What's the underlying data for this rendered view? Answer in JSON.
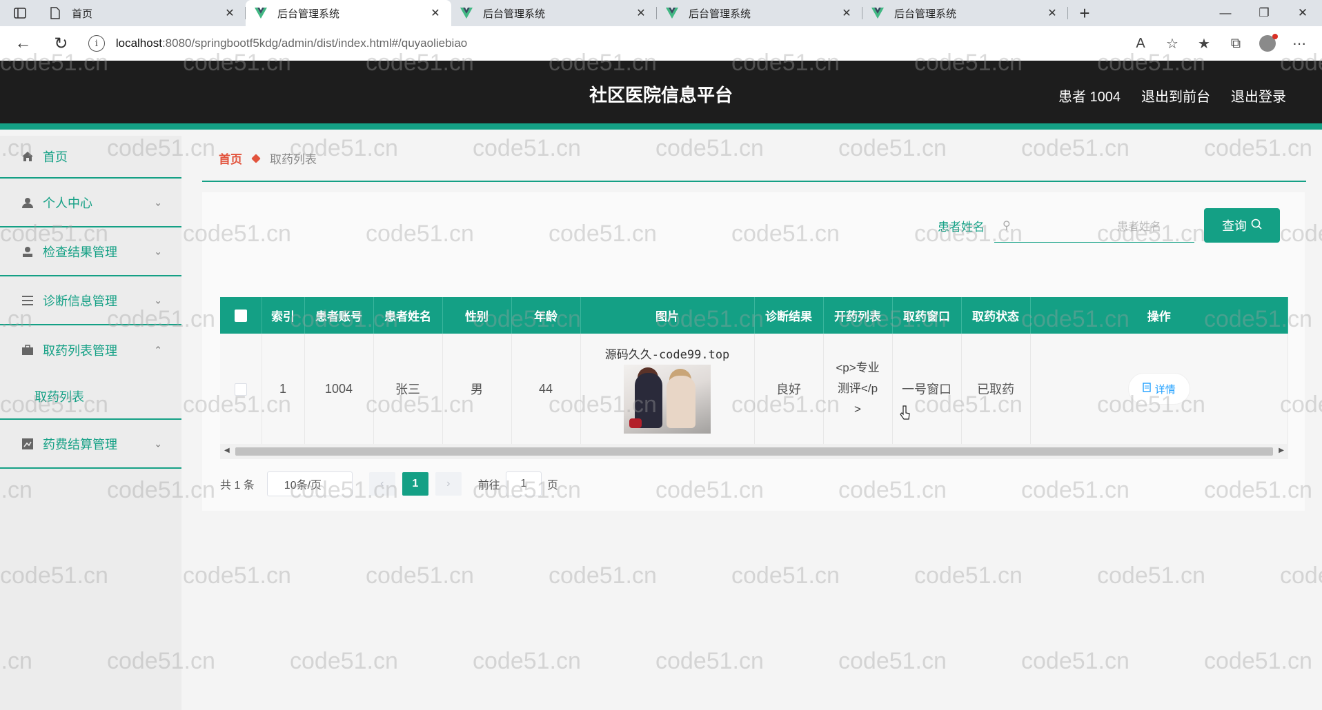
{
  "browser": {
    "tabs": [
      {
        "title": "首页",
        "icon": "page-icon",
        "active": false
      },
      {
        "title": "后台管理系统",
        "icon": "vue-icon",
        "active": true
      },
      {
        "title": "后台管理系统",
        "icon": "vue-icon",
        "active": false
      },
      {
        "title": "后台管理系统",
        "icon": "vue-icon",
        "active": false
      },
      {
        "title": "后台管理系统",
        "icon": "vue-icon",
        "active": false
      }
    ],
    "url_host": "localhost",
    "url_path": ":8080/springbootf5kdg/admin/dist/index.html#/quyaoliebiao"
  },
  "header": {
    "title": "社区医院信息平台",
    "user": "患者 1004",
    "to_front": "退出到前台",
    "logout": "退出登录"
  },
  "sidebar": {
    "home": "首页",
    "personal": "个人中心",
    "exam": "检查结果管理",
    "diagnosis": "诊断信息管理",
    "pickup": "取药列表管理",
    "pickup_sub": "取药列表",
    "fee": "药费结算管理"
  },
  "breadcrumb": {
    "home": "首页",
    "current": "取药列表"
  },
  "search": {
    "label": "患者姓名",
    "placeholder": "患者姓名",
    "button": "查询"
  },
  "table": {
    "headers": [
      "索引",
      "患者账号",
      "患者姓名",
      "性别",
      "年龄",
      "图片",
      "诊断结果",
      "开药列表",
      "取药窗口",
      "取药状态",
      "操作"
    ],
    "rows": [
      {
        "index": "1",
        "account": "1004",
        "name": "张三",
        "gender": "男",
        "age": "44",
        "image_caption": "源码久久-code99.top",
        "diagnosis": "良好",
        "prescription_l1": "<p>专业",
        "prescription_l2": "测评</p",
        "prescription_l3": ">",
        "window": "一号窗口",
        "status": "已取药",
        "action": "详情"
      }
    ]
  },
  "pager": {
    "total": "共 1 条",
    "size": "10条/页",
    "current_page": "1",
    "goto": "前往",
    "jump_value": "1",
    "page_unit": "页"
  },
  "watermark": "code51.cn",
  "colors": {
    "accent": "#14a085",
    "header_bg": "#1d1d1d",
    "breadcrumb_home": "#e2533c"
  }
}
